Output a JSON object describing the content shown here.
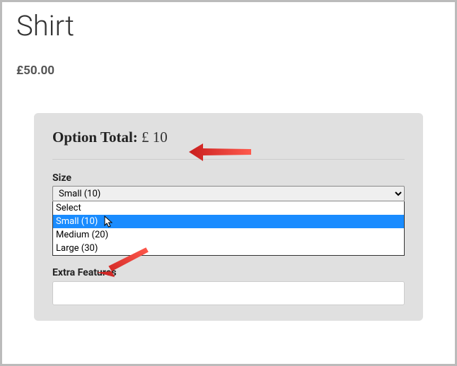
{
  "product": {
    "title": "Shirt",
    "price": "£50.00"
  },
  "options": {
    "total_label": "Option Total:",
    "total_value": "£ 10",
    "size": {
      "label": "Size",
      "selected": "Small (10)",
      "items": {
        "placeholder": "Select",
        "small": "Small (10)",
        "medium": "Medium (20)",
        "large": "Large (30)"
      }
    },
    "extra": {
      "label": "Extra Features",
      "value": ""
    }
  }
}
